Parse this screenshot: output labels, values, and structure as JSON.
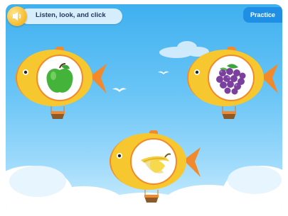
{
  "header": {
    "prompt": "Listen, look, and click",
    "practice_label": "Practice"
  },
  "choices": [
    {
      "item": "apple"
    },
    {
      "item": "grapes"
    },
    {
      "item": "banana"
    }
  ],
  "colors": {
    "sky_top": "#3fb0ef",
    "sky_bottom": "#cdeefe",
    "fish_body": "#f7c72f",
    "fish_accent": "#f28a2c",
    "practice_tab": "#1f8fe6"
  }
}
